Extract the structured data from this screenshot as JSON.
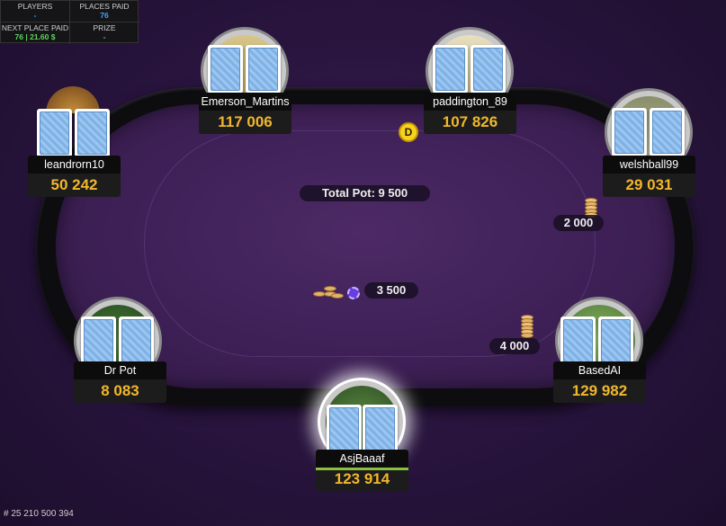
{
  "info": {
    "players_label": "PLAYERS",
    "players_value": "-",
    "places_paid_label": "PLACES PAID",
    "places_paid_value": "76",
    "next_place_label": "NEXT PLACE PAID",
    "next_place_value": "76 | 21.60 $",
    "prize_label": "PRIZE",
    "prize_value": "-"
  },
  "pot": {
    "label": "Total Pot: 9 500"
  },
  "bets": {
    "center": "3 500",
    "right_top": "2 000",
    "right_bottom": "4 000"
  },
  "dealer_button": "D",
  "seats": {
    "emerson": {
      "name": "Emerson_Martins",
      "stack": "117 006"
    },
    "paddington": {
      "name": "paddington_89",
      "stack": "107 826"
    },
    "leandrorn": {
      "name": "leandrorn10",
      "stack": "50 242"
    },
    "welshball": {
      "name": "welshball99",
      "stack": "29 031"
    },
    "drpot": {
      "name": "Dr Pot",
      "stack": "8 083"
    },
    "basedai": {
      "name": "BasedAI",
      "stack": "129 982"
    },
    "hero": {
      "name": "AsjBaaaf",
      "stack": "123 914"
    }
  },
  "hand_id": "# 25 210 500 394"
}
